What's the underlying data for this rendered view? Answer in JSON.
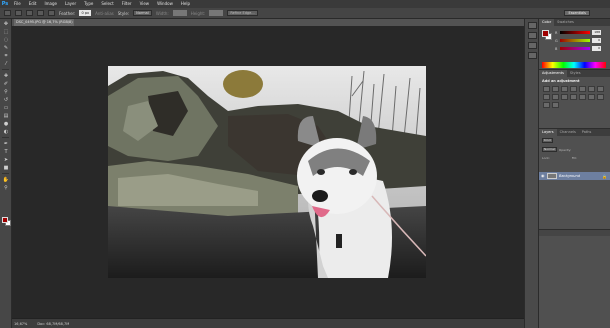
{
  "app": {
    "logo": "Ps"
  },
  "menu": [
    "File",
    "Edit",
    "Image",
    "Layer",
    "Type",
    "Select",
    "Filter",
    "View",
    "Window",
    "Help"
  ],
  "options": {
    "feather_label": "Feather:",
    "feather_value": "0 px",
    "antialias_label": "Anti-alias",
    "style_label": "Style:",
    "style_value": "Normal",
    "width_label": "Width:",
    "height_label": "Height:",
    "refine_edge": "Refine Edge...",
    "workspace": "Essentials"
  },
  "document": {
    "tab_title": "DSC_0495.JPG @ 16,7% (RGB/8)",
    "zoom": "16,67%",
    "doc_size": "Doc: 68,7M/68,7M"
  },
  "color_panel": {
    "tabs": [
      "Color",
      "Swatches"
    ],
    "sliders": [
      {
        "label": "R",
        "value": "188"
      },
      {
        "label": "G",
        "value": "0"
      },
      {
        "label": "B",
        "value": "0"
      }
    ],
    "foreground": "#a00000",
    "background": "#ffffff"
  },
  "adjustments_panel": {
    "tabs": [
      "Adjustments",
      "Styles"
    ],
    "title": "Add an adjustment"
  },
  "layers_panel": {
    "tabs": [
      "Layers",
      "Channels",
      "Paths"
    ],
    "kind_label": "Kind",
    "blend_mode": "Normal",
    "opacity_label": "Opacity:",
    "lock_label": "Lock:",
    "fill_label": "Fill:",
    "layers": [
      {
        "name": "Background",
        "locked": true
      }
    ]
  }
}
